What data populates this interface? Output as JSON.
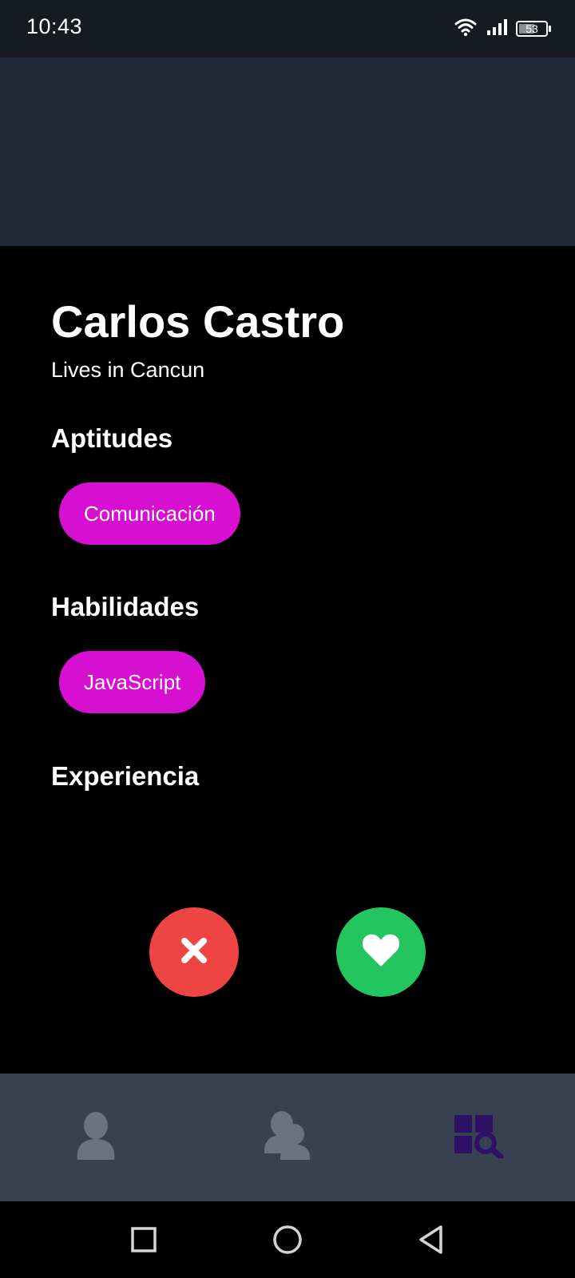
{
  "status_bar": {
    "time": "10:43",
    "battery": "53",
    "icons": [
      "wifi-icon",
      "signal-icon",
      "battery-icon"
    ]
  },
  "profile": {
    "name": "Carlos Castro",
    "location": "Lives in Cancun"
  },
  "sections": {
    "aptitudes": {
      "title": "Aptitudes",
      "chips": [
        "Comunicación"
      ]
    },
    "habilidades": {
      "title": "Habilidades",
      "chips": [
        "JavaScript"
      ]
    },
    "experiencia": {
      "title": "Experiencia"
    }
  },
  "actions": {
    "reject_icon": "close-icon",
    "like_icon": "heart-icon"
  },
  "bottom_nav": {
    "items": [
      {
        "icon": "user-icon",
        "active": false
      },
      {
        "icon": "users-icon",
        "active": false
      },
      {
        "icon": "search-grid-icon",
        "active": true
      }
    ]
  },
  "colors": {
    "status_bar": "#161a22",
    "banner": "#1f2937",
    "background": "#000000",
    "chip": "#d60fd1",
    "reject": "#ef4444",
    "like": "#22c55e",
    "nav_bg": "#374151",
    "nav_inactive": "#6b7280",
    "nav_active": "#2e1065"
  }
}
